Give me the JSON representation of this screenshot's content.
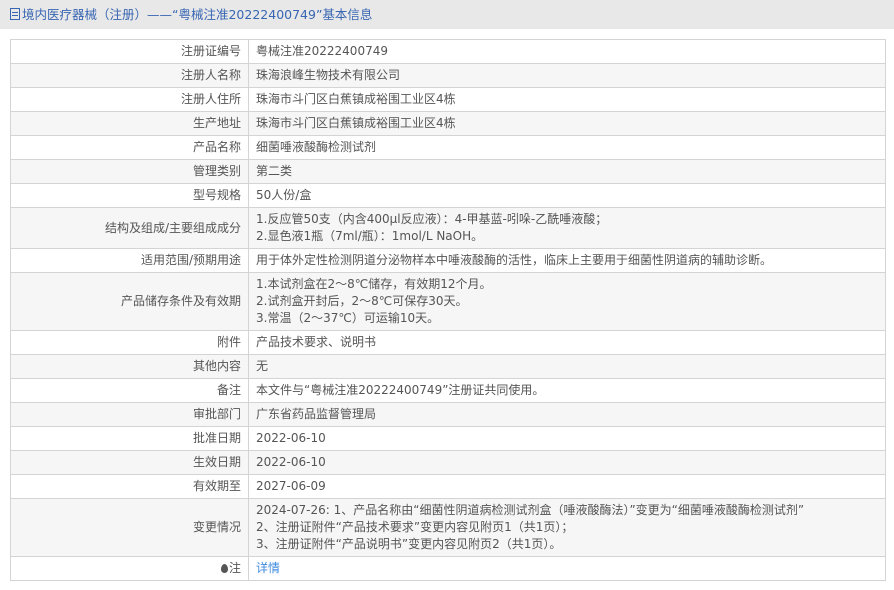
{
  "header": {
    "title": "境内医疗器械（注册）——“粤械注准20222400749”基本信息",
    "icon": "document-icon"
  },
  "rows": [
    {
      "label": "注册证编号",
      "value": [
        "粤械注准20222400749"
      ]
    },
    {
      "label": "注册人名称",
      "value": [
        "珠海浪峰生物技术有限公司"
      ]
    },
    {
      "label": "注册人住所",
      "value": [
        "珠海市斗门区白蕉镇成裕围工业区4栋"
      ]
    },
    {
      "label": "生产地址",
      "value": [
        "珠海市斗门区白蕉镇成裕围工业区4栋"
      ]
    },
    {
      "label": "产品名称",
      "value": [
        "细菌唾液酸酶检测试剂"
      ]
    },
    {
      "label": "管理类别",
      "value": [
        "第二类"
      ]
    },
    {
      "label": "型号规格",
      "value": [
        "50人份/盒"
      ]
    },
    {
      "label": "结构及组成/主要组成成分",
      "value": [
        "1.反应管50支（内含400μl反应液）：4-甲基蓝-吲哚-乙酰唾液酸；",
        "2.显色液1瓶（7ml/瓶）：1mol/L NaOH。"
      ]
    },
    {
      "label": "适用范围/预期用途",
      "value": [
        "用于体外定性检测阴道分泌物样本中唾液酸酶的活性，临床上主要用于细菌性阴道病的辅助诊断。"
      ]
    },
    {
      "label": "产品储存条件及有效期",
      "value": [
        "1.本试剂盒在2～8℃储存，有效期12个月。",
        "2.试剂盒开封后，2～8℃可保存30天。",
        "3.常温（2～37℃）可运输10天。"
      ]
    },
    {
      "label": "附件",
      "value": [
        "产品技术要求、说明书"
      ]
    },
    {
      "label": "其他内容",
      "value": [
        "无"
      ]
    },
    {
      "label": "备注",
      "value": [
        "本文件与“粤械注准20222400749”注册证共同使用。"
      ]
    },
    {
      "label": "审批部门",
      "value": [
        "广东省药品监督管理局"
      ]
    },
    {
      "label": "批准日期",
      "value": [
        "2022-06-10"
      ]
    },
    {
      "label": "生效日期",
      "value": [
        "2022-06-10"
      ]
    },
    {
      "label": "有效期至",
      "value": [
        "2027-06-09"
      ]
    },
    {
      "label": "变更情况",
      "value": [
        "2024-07-26: 1、产品名称由“细菌性阴道病检测试剂盒（唾液酸酶法）”变更为“细菌唾液酸酶检测试剂”",
        "2、注册证附件“产品技术要求”变更内容见附页1（共1页）；",
        "3、注册证附件“产品说明书”变更内容见附页2（共1页）。"
      ]
    }
  ],
  "note": {
    "label": "注",
    "link": "详情",
    "icon": "pin-icon"
  }
}
